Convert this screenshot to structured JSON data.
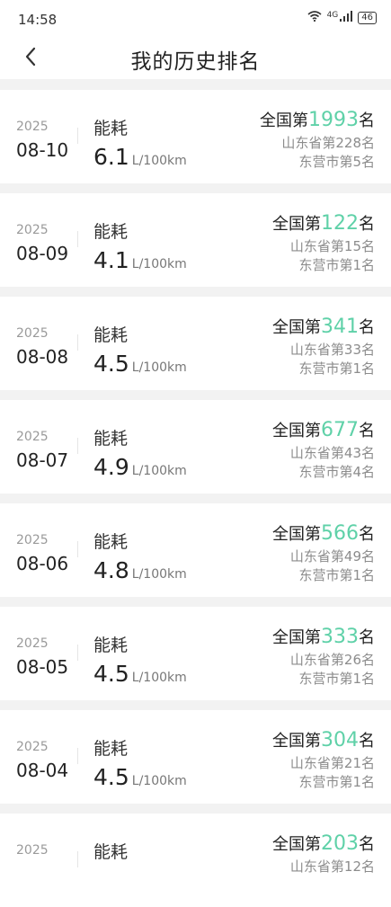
{
  "status": {
    "time": "14:58",
    "signal_label": "4G",
    "battery": "46"
  },
  "header": {
    "title": "我的历史排名"
  },
  "rows": [
    {
      "year": "2025",
      "date": "08-10",
      "metric_label": "能耗",
      "metric_value": "6.1",
      "unit": "L/100km",
      "national_prefix": "全国第",
      "national_rank": "1993",
      "national_suffix": "名",
      "province_rank": "山东省第228名",
      "city_rank": "东营市第5名"
    },
    {
      "year": "2025",
      "date": "08-09",
      "metric_label": "能耗",
      "metric_value": "4.1",
      "unit": "L/100km",
      "national_prefix": "全国第",
      "national_rank": "122",
      "national_suffix": "名",
      "province_rank": "山东省第15名",
      "city_rank": "东营市第1名"
    },
    {
      "year": "2025",
      "date": "08-08",
      "metric_label": "能耗",
      "metric_value": "4.5",
      "unit": "L/100km",
      "national_prefix": "全国第",
      "national_rank": "341",
      "national_suffix": "名",
      "province_rank": "山东省第33名",
      "city_rank": "东营市第1名"
    },
    {
      "year": "2025",
      "date": "08-07",
      "metric_label": "能耗",
      "metric_value": "4.9",
      "unit": "L/100km",
      "national_prefix": "全国第",
      "national_rank": "677",
      "national_suffix": "名",
      "province_rank": "山东省第43名",
      "city_rank": "东营市第4名"
    },
    {
      "year": "2025",
      "date": "08-06",
      "metric_label": "能耗",
      "metric_value": "4.8",
      "unit": "L/100km",
      "national_prefix": "全国第",
      "national_rank": "566",
      "national_suffix": "名",
      "province_rank": "山东省第49名",
      "city_rank": "东营市第1名"
    },
    {
      "year": "2025",
      "date": "08-05",
      "metric_label": "能耗",
      "metric_value": "4.5",
      "unit": "L/100km",
      "national_prefix": "全国第",
      "national_rank": "333",
      "national_suffix": "名",
      "province_rank": "山东省第26名",
      "city_rank": "东营市第1名"
    },
    {
      "year": "2025",
      "date": "08-04",
      "metric_label": "能耗",
      "metric_value": "4.5",
      "unit": "L/100km",
      "national_prefix": "全国第",
      "national_rank": "304",
      "national_suffix": "名",
      "province_rank": "山东省第21名",
      "city_rank": "东营市第1名"
    },
    {
      "year": "2025",
      "date": "",
      "metric_label": "能耗",
      "metric_value": "",
      "unit": "",
      "national_prefix": "全国第",
      "national_rank": "203",
      "national_suffix": "名",
      "province_rank": "山东省第12名",
      "city_rank": ""
    }
  ],
  "accent_color": "#5fd1a8"
}
